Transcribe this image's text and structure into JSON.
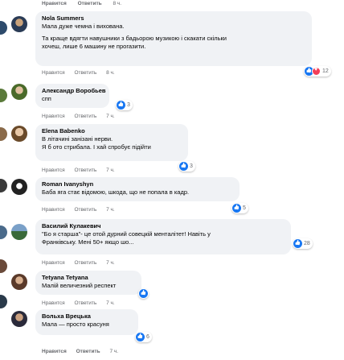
{
  "top_actions": {
    "like": "Нравится",
    "reply": "Ответить",
    "time": "8 ч."
  },
  "comments": [
    {
      "author": "Nola Summers",
      "lines": [
        "Мала дуже чемна і вихована.",
        "",
        "Та краще вдягти навушники з бадьорою музикою і скакати скільки",
        "хочеш, лише 6 машину не прогазити."
      ],
      "like": "Нравится",
      "reply": "Ответить",
      "time": "8 ч.",
      "reactions": "12"
    },
    {
      "author": "Александр Воробьев",
      "lines": [
        "спп"
      ],
      "like": "Нравится",
      "reply": "Ответить",
      "time": "7 ч.",
      "reactions": "3"
    },
    {
      "author": "Elena Babenko",
      "lines": [
        "В літачині занізані нерви.",
        "Я б ото стрибала. І хай спробує підійти"
      ],
      "like": "Нравится",
      "reply": "Ответить",
      "time": "7 ч.",
      "reactions": "3"
    },
    {
      "author": "Roman Ivanyshyn",
      "lines": [
        "Баба яга стає відомою, шкода, що не попала в кадр."
      ],
      "like": "Нравится",
      "reply": "Ответить",
      "time": "7 ч.",
      "reactions": "5"
    },
    {
      "author": "Василий Кулакевич",
      "lines": [
        "\"Бо я старша\"- це отой дурний совецкій менталітет! Навіть у",
        "Франківську. Мені 50+ якщо шо..."
      ],
      "like": "Нравится",
      "reply": "Ответить",
      "time": "7 ч.",
      "reactions": "28"
    },
    {
      "author": "Tetyana Tetyana",
      "lines": [
        "Малій величезний респект"
      ],
      "like": "Нравится",
      "reply": "Ответить",
      "time": "7 ч.",
      "reactions": ""
    },
    {
      "author": "Вольха Врецька",
      "lines": [
        "Мала — просто красуня"
      ],
      "like": "Нравится",
      "reply": "Ответить",
      "time": "7 ч.",
      "reactions": "6"
    }
  ],
  "colors": {
    "bubble": "#f0f2f5",
    "like": "#1877f2",
    "heart": "#f33e58",
    "meta": "#65676b"
  }
}
